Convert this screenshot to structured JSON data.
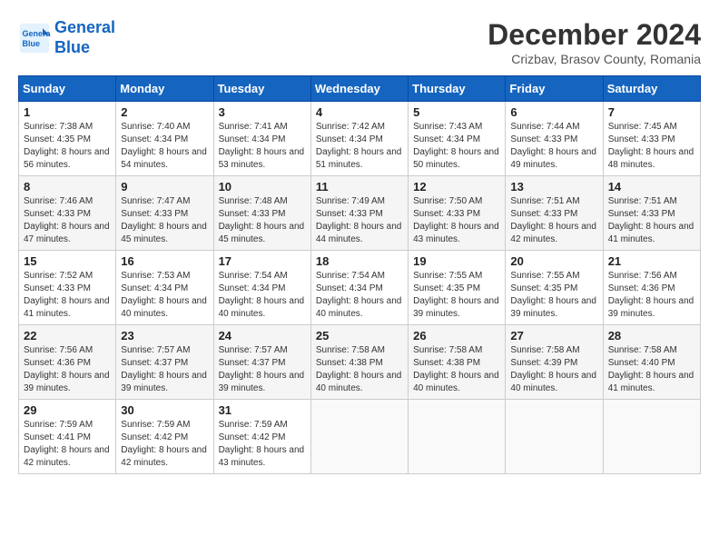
{
  "header": {
    "logo_line1": "General",
    "logo_line2": "Blue",
    "month_title": "December 2024",
    "location": "Crizbav, Brasov County, Romania"
  },
  "weekdays": [
    "Sunday",
    "Monday",
    "Tuesday",
    "Wednesday",
    "Thursday",
    "Friday",
    "Saturday"
  ],
  "weeks": [
    [
      {
        "day": "1",
        "sunrise": "7:38 AM",
        "sunset": "4:35 PM",
        "daylight": "8 hours and 56 minutes."
      },
      {
        "day": "2",
        "sunrise": "7:40 AM",
        "sunset": "4:34 PM",
        "daylight": "8 hours and 54 minutes."
      },
      {
        "day": "3",
        "sunrise": "7:41 AM",
        "sunset": "4:34 PM",
        "daylight": "8 hours and 53 minutes."
      },
      {
        "day": "4",
        "sunrise": "7:42 AM",
        "sunset": "4:34 PM",
        "daylight": "8 hours and 51 minutes."
      },
      {
        "day": "5",
        "sunrise": "7:43 AM",
        "sunset": "4:34 PM",
        "daylight": "8 hours and 50 minutes."
      },
      {
        "day": "6",
        "sunrise": "7:44 AM",
        "sunset": "4:33 PM",
        "daylight": "8 hours and 49 minutes."
      },
      {
        "day": "7",
        "sunrise": "7:45 AM",
        "sunset": "4:33 PM",
        "daylight": "8 hours and 48 minutes."
      }
    ],
    [
      {
        "day": "8",
        "sunrise": "7:46 AM",
        "sunset": "4:33 PM",
        "daylight": "8 hours and 47 minutes."
      },
      {
        "day": "9",
        "sunrise": "7:47 AM",
        "sunset": "4:33 PM",
        "daylight": "8 hours and 45 minutes."
      },
      {
        "day": "10",
        "sunrise": "7:48 AM",
        "sunset": "4:33 PM",
        "daylight": "8 hours and 45 minutes."
      },
      {
        "day": "11",
        "sunrise": "7:49 AM",
        "sunset": "4:33 PM",
        "daylight": "8 hours and 44 minutes."
      },
      {
        "day": "12",
        "sunrise": "7:50 AM",
        "sunset": "4:33 PM",
        "daylight": "8 hours and 43 minutes."
      },
      {
        "day": "13",
        "sunrise": "7:51 AM",
        "sunset": "4:33 PM",
        "daylight": "8 hours and 42 minutes."
      },
      {
        "day": "14",
        "sunrise": "7:51 AM",
        "sunset": "4:33 PM",
        "daylight": "8 hours and 41 minutes."
      }
    ],
    [
      {
        "day": "15",
        "sunrise": "7:52 AM",
        "sunset": "4:33 PM",
        "daylight": "8 hours and 41 minutes."
      },
      {
        "day": "16",
        "sunrise": "7:53 AM",
        "sunset": "4:34 PM",
        "daylight": "8 hours and 40 minutes."
      },
      {
        "day": "17",
        "sunrise": "7:54 AM",
        "sunset": "4:34 PM",
        "daylight": "8 hours and 40 minutes."
      },
      {
        "day": "18",
        "sunrise": "7:54 AM",
        "sunset": "4:34 PM",
        "daylight": "8 hours and 40 minutes."
      },
      {
        "day": "19",
        "sunrise": "7:55 AM",
        "sunset": "4:35 PM",
        "daylight": "8 hours and 39 minutes."
      },
      {
        "day": "20",
        "sunrise": "7:55 AM",
        "sunset": "4:35 PM",
        "daylight": "8 hours and 39 minutes."
      },
      {
        "day": "21",
        "sunrise": "7:56 AM",
        "sunset": "4:36 PM",
        "daylight": "8 hours and 39 minutes."
      }
    ],
    [
      {
        "day": "22",
        "sunrise": "7:56 AM",
        "sunset": "4:36 PM",
        "daylight": "8 hours and 39 minutes."
      },
      {
        "day": "23",
        "sunrise": "7:57 AM",
        "sunset": "4:37 PM",
        "daylight": "8 hours and 39 minutes."
      },
      {
        "day": "24",
        "sunrise": "7:57 AM",
        "sunset": "4:37 PM",
        "daylight": "8 hours and 39 minutes."
      },
      {
        "day": "25",
        "sunrise": "7:58 AM",
        "sunset": "4:38 PM",
        "daylight": "8 hours and 40 minutes."
      },
      {
        "day": "26",
        "sunrise": "7:58 AM",
        "sunset": "4:38 PM",
        "daylight": "8 hours and 40 minutes."
      },
      {
        "day": "27",
        "sunrise": "7:58 AM",
        "sunset": "4:39 PM",
        "daylight": "8 hours and 40 minutes."
      },
      {
        "day": "28",
        "sunrise": "7:58 AM",
        "sunset": "4:40 PM",
        "daylight": "8 hours and 41 minutes."
      }
    ],
    [
      {
        "day": "29",
        "sunrise": "7:59 AM",
        "sunset": "4:41 PM",
        "daylight": "8 hours and 42 minutes."
      },
      {
        "day": "30",
        "sunrise": "7:59 AM",
        "sunset": "4:42 PM",
        "daylight": "8 hours and 42 minutes."
      },
      {
        "day": "31",
        "sunrise": "7:59 AM",
        "sunset": "4:42 PM",
        "daylight": "8 hours and 43 minutes."
      },
      null,
      null,
      null,
      null
    ]
  ]
}
